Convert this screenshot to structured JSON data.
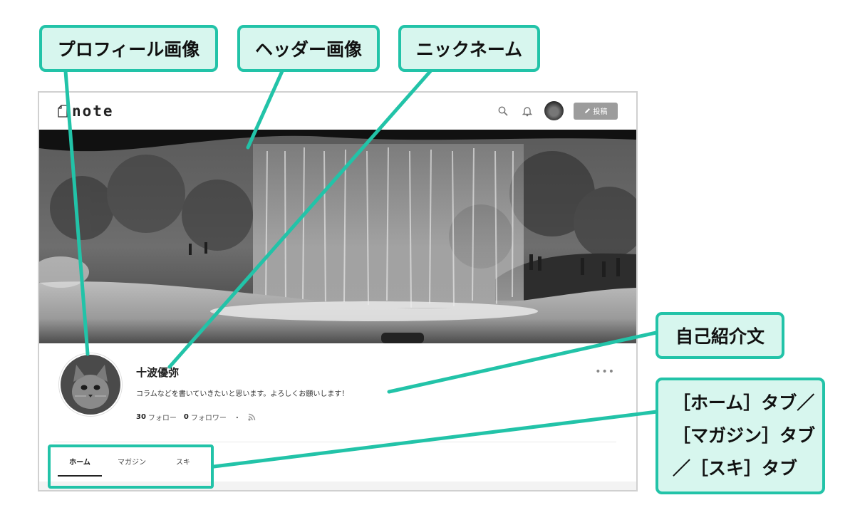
{
  "annotations": {
    "profile_image": "プロフィール画像",
    "header_image": "ヘッダー画像",
    "nickname": "ニックネーム",
    "bio": "自己紹介文",
    "tabs_line1": "［ホーム］タブ／",
    "tabs_line2": "［マガジン］タブ",
    "tabs_line3": "／［スキ］タブ"
  },
  "colors": {
    "callout_border": "#22c3a8",
    "callout_fill": "#d7f6ee"
  },
  "app": {
    "logo": "note",
    "post_button": "投稿",
    "icons": [
      "note-logo-icon",
      "search-icon",
      "bell-icon",
      "avatar",
      "pencil-icon"
    ]
  },
  "profile": {
    "nickname": "十波優弥",
    "bio": "コラムなどを書いていきたいと思います。よろしくお願いします！",
    "follow_count": "30",
    "follow_label": "フォロー",
    "follower_count": "0",
    "follower_label": "フォロワー",
    "separator": "・",
    "more": "•••"
  },
  "tabs": [
    "ホーム",
    "マガジン",
    "スキ"
  ]
}
